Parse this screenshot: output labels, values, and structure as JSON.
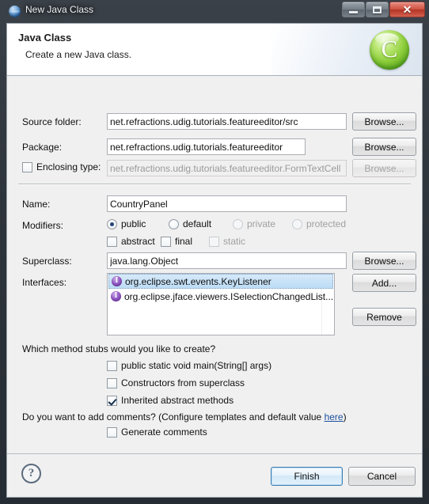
{
  "window": {
    "title": "New Java Class",
    "icon": "eclipse-globe-icon",
    "buttons": {
      "minimize": "minimize-icon",
      "maximize": "maximize-icon",
      "close": "✕"
    }
  },
  "header": {
    "title": "Java Class",
    "subtitle": "Create a new Java class.",
    "icon_letter": "C"
  },
  "form": {
    "source_folder": {
      "label": "Source folder:",
      "value": "net.refractions.udig.tutorials.featureeditor/src",
      "browse": "Browse..."
    },
    "package": {
      "label": "Package:",
      "value": "net.refractions.udig.tutorials.featureeditor",
      "browse": "Browse..."
    },
    "enclosing_type": {
      "label": "Enclosing type:",
      "checked": false,
      "value": "net.refractions.udig.tutorials.featureeditor.FormTextCell",
      "browse": "Browse...",
      "disabled": true
    },
    "name": {
      "label": "Name:",
      "value": "CountryPanel"
    },
    "modifiers": {
      "label": "Modifiers:",
      "radios": [
        {
          "label": "public",
          "checked": true,
          "disabled": false
        },
        {
          "label": "default",
          "checked": false,
          "disabled": false
        },
        {
          "label": "private",
          "checked": false,
          "disabled": true
        },
        {
          "label": "protected",
          "checked": false,
          "disabled": true
        }
      ],
      "checkboxes": [
        {
          "label": "abstract",
          "checked": false,
          "disabled": false
        },
        {
          "label": "final",
          "checked": false,
          "disabled": false
        },
        {
          "label": "static",
          "checked": false,
          "disabled": true
        }
      ]
    },
    "superclass": {
      "label": "Superclass:",
      "value": "java.lang.Object",
      "browse": "Browse..."
    },
    "interfaces": {
      "label": "Interfaces:",
      "items": [
        {
          "name": "org.eclipse.swt.events.KeyListener",
          "selected": true
        },
        {
          "name": "org.eclipse.jface.viewers.ISelectionChangedList...",
          "selected": false
        }
      ],
      "add": "Add...",
      "remove": "Remove"
    }
  },
  "stubs": {
    "question": "Which method stubs would you like to create?",
    "options": [
      {
        "label": "public static void main(String[] args)",
        "checked": false
      },
      {
        "label": "Constructors from superclass",
        "checked": false
      },
      {
        "label": "Inherited abstract methods",
        "checked": true
      }
    ]
  },
  "comments": {
    "question_before": "Do you want to add comments? (Configure templates and default value ",
    "link": "here",
    "question_after": ")",
    "option": {
      "label": "Generate comments",
      "checked": false
    }
  },
  "footer": {
    "help": "?",
    "finish": "Finish",
    "cancel": "Cancel"
  }
}
